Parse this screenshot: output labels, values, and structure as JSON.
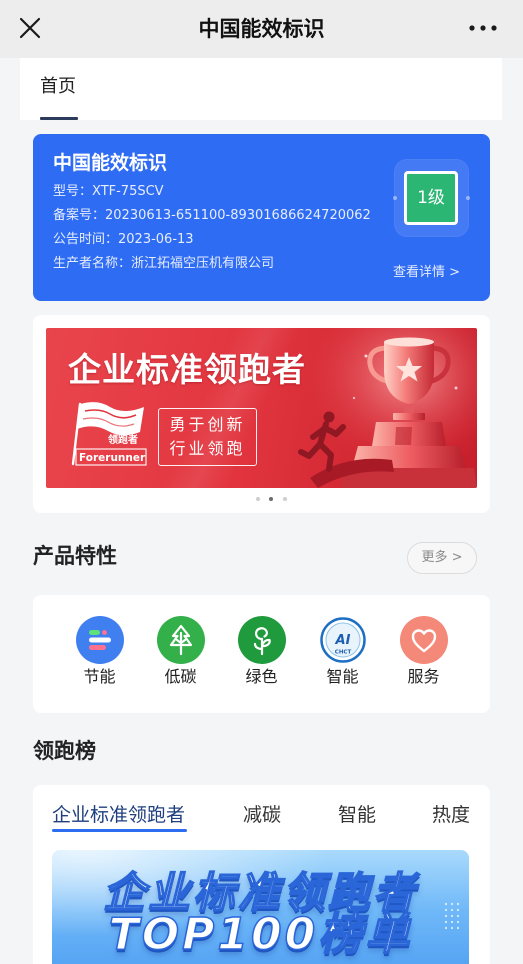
{
  "header": {
    "title": "中国能效标识",
    "close_icon": "close-icon",
    "more_icon": "more-icon"
  },
  "top_tabs": [
    {
      "label": "首页",
      "active": true
    }
  ],
  "label_card": {
    "title": "中国能效标识",
    "fields": [
      {
        "label": "型号：",
        "value": "XTF-75SCV"
      },
      {
        "label": "备案号：",
        "value": "20230613-651100-89301686624720062"
      },
      {
        "label": "公告时间：",
        "value": "2023-06-13"
      },
      {
        "label": "生产者名称：",
        "value": "浙江拓福空压机有限公司"
      }
    ],
    "grade": "1级",
    "detail_link": "查看详情 >",
    "background_color": "#2f6cf4",
    "grade_color": "#2bb673"
  },
  "banner": {
    "headline": "企业标准领跑者",
    "logo_cn": "领跑者",
    "logo_en": "Forerunner",
    "slogan": [
      "勇于创新",
      "行业领跑"
    ],
    "illustration": "trophy-icon",
    "background_color": "#e0343e",
    "slide_count": 3,
    "active_slide_index": 1
  },
  "features": {
    "title": "产品特性",
    "more_label": "更多 >",
    "items": [
      {
        "label": "节能",
        "icon": "energy-saving-icon",
        "color": "#3f7fef"
      },
      {
        "label": "低碳",
        "icon": "tree-icon",
        "color": "#34b04a"
      },
      {
        "label": "绿色",
        "icon": "sprout-icon",
        "color": "#1f9b3d"
      },
      {
        "label": "智能",
        "icon": "chct-ai-logo",
        "color": "#ffffff",
        "logo_mark": "AI",
        "logo_text": "CHCT"
      },
      {
        "label": "服务",
        "icon": "heart-icon",
        "color": "#f4897a"
      }
    ]
  },
  "leaderboard": {
    "title": "领跑榜",
    "tabs": [
      {
        "label": "企业标准领跑者",
        "active": true
      },
      {
        "label": "减碳",
        "active": false
      },
      {
        "label": "智能",
        "active": false
      },
      {
        "label": "热度",
        "active": false
      }
    ],
    "accent_color": "#2b6cf0",
    "banner": {
      "line1": "企业标准领跑者",
      "line2": "TOP100榜单"
    }
  }
}
